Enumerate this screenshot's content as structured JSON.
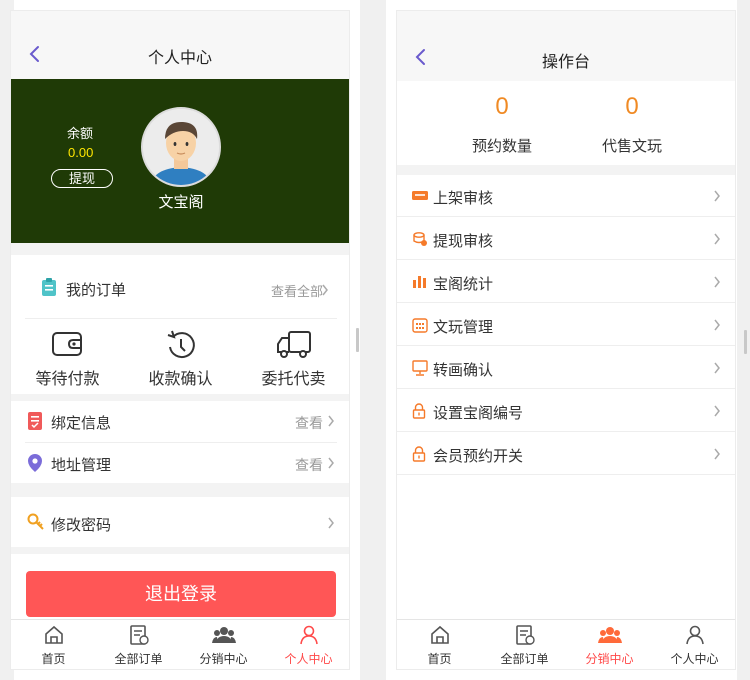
{
  "left": {
    "nav_title": "个人中心",
    "balance_label": "余额",
    "balance_value": "0.00",
    "withdraw_label": "提现",
    "username": "文宝阁",
    "orders_title": "我的订单",
    "orders_link": "查看全部",
    "order_items": [
      {
        "label": "等待付款",
        "icon": "wallet-icon"
      },
      {
        "label": "收款确认",
        "icon": "clock-icon"
      },
      {
        "label": "委托代卖",
        "icon": "truck-icon"
      }
    ],
    "info_rows": [
      {
        "label": "绑定信息",
        "value": "查看",
        "icon": "document-icon"
      },
      {
        "label": "地址管理",
        "value": "查看",
        "icon": "location-icon"
      }
    ],
    "password_label": "修改密码",
    "logout_label": "退出登录",
    "tabs": [
      "首页",
      "全部订单",
      "分销中心",
      "个人中心"
    ],
    "active_tab": 3
  },
  "right": {
    "nav_title": "操作台",
    "stats": [
      {
        "value": "0",
        "label": "预约数量"
      },
      {
        "value": "0",
        "label": "代售文玩"
      }
    ],
    "menu": [
      {
        "label": "上架审核",
        "icon": "card-icon"
      },
      {
        "label": "提现审核",
        "icon": "coins-icon"
      },
      {
        "label": "宝阁统计",
        "icon": "bar-chart-icon"
      },
      {
        "label": "文玩管理",
        "icon": "calendar-icon"
      },
      {
        "label": "转画确认",
        "icon": "monitor-icon"
      },
      {
        "label": "设置宝阁编号",
        "icon": "lock-icon"
      },
      {
        "label": "会员预约开关",
        "icon": "lock-icon"
      }
    ],
    "tabs": [
      "首页",
      "全部订单",
      "分销中心",
      "个人中心"
    ],
    "active_tab": 2
  },
  "colors": {
    "hero_bg": "#1f3a06",
    "balance_yellow": "#ffe600",
    "logout_red": "#ff5656",
    "active_tab_red": "#ff4a4a",
    "accent_orange": "#f08a24",
    "back_purple": "#6a5acd"
  }
}
